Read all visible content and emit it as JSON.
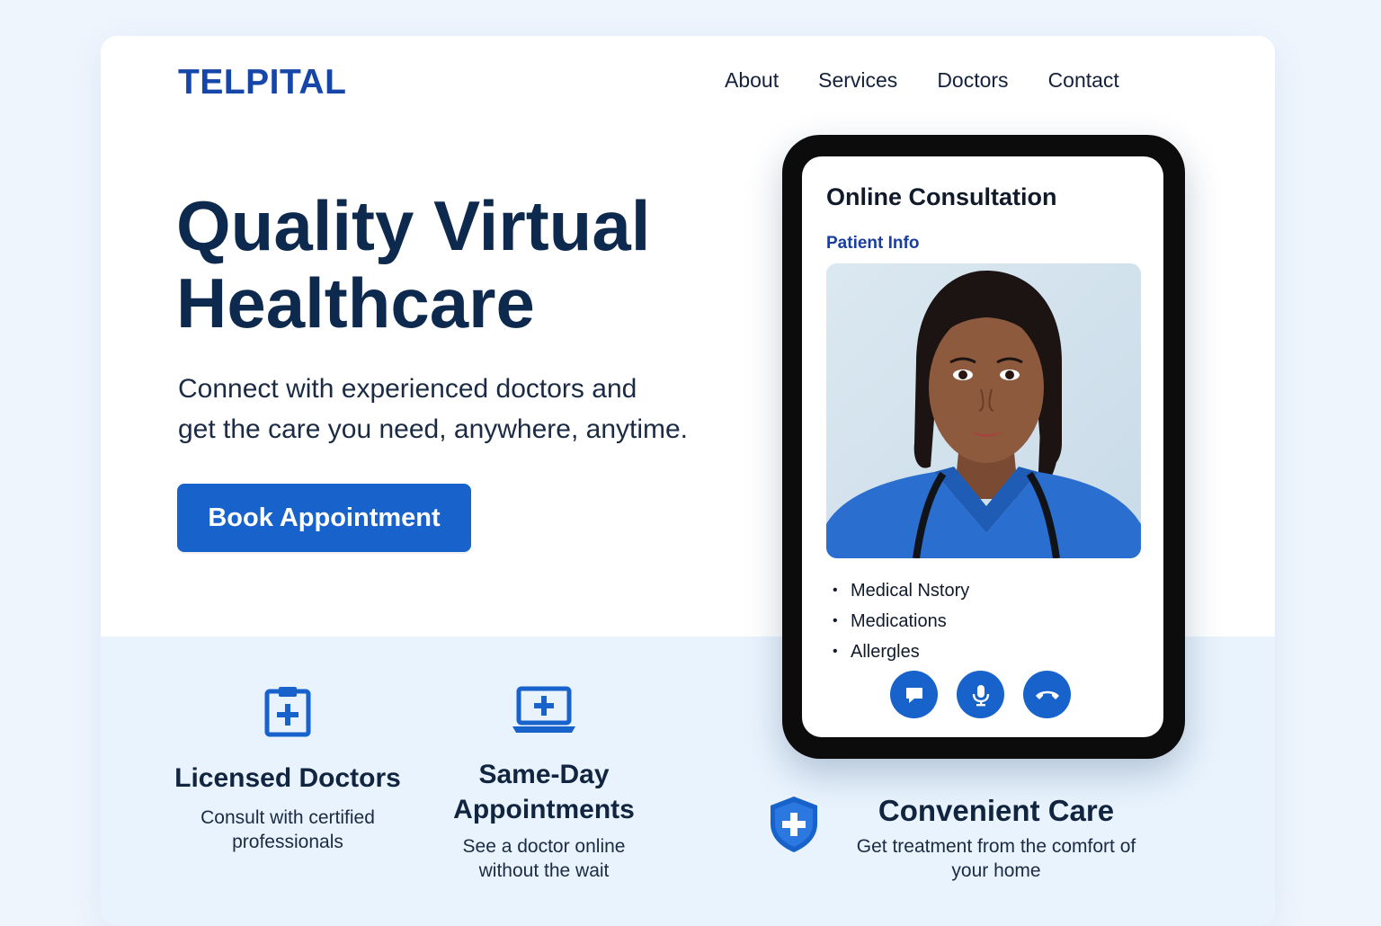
{
  "brand": {
    "name": "TELPITAL"
  },
  "nav": {
    "items": [
      "About",
      "Services",
      "Doctors",
      "Contact"
    ]
  },
  "hero": {
    "title_line1": "Quality Virtual",
    "title_line2": "Healthcare",
    "subtitle_line1": "Connect with experienced doctors and",
    "subtitle_line2": "get the care you need, anywhere, anytime.",
    "cta_label": "Book Appointment"
  },
  "consultation": {
    "title": "Online Consultation",
    "section_label": "Patient Info",
    "photo_icon": "doctor-portrait",
    "info_items": [
      "Medical Nstory",
      "Medications",
      "Allergles"
    ],
    "controls": [
      "chat-icon",
      "microphone-icon",
      "hang-up-icon"
    ]
  },
  "features": [
    {
      "icon": "clipboard-plus-icon",
      "title": "Licensed Doctors",
      "desc_line1": "Consult with certified",
      "desc_line2": "professionals"
    },
    {
      "icon": "laptop-plus-icon",
      "title_line1": "Same-Day",
      "title_line2": "Appointments",
      "desc_line1": "See a doctor online",
      "desc_line2": "without the wait"
    },
    {
      "icon": "shield-plus-icon",
      "title": "Convenient Care",
      "desc_line1": "Get treatment from the comfort of",
      "desc_line2": "your home"
    }
  ],
  "colors": {
    "brand": "#1646a8",
    "accent": "#1862cc",
    "heading": "#0d2a4e",
    "panel_bg": "#e8f3fd"
  }
}
